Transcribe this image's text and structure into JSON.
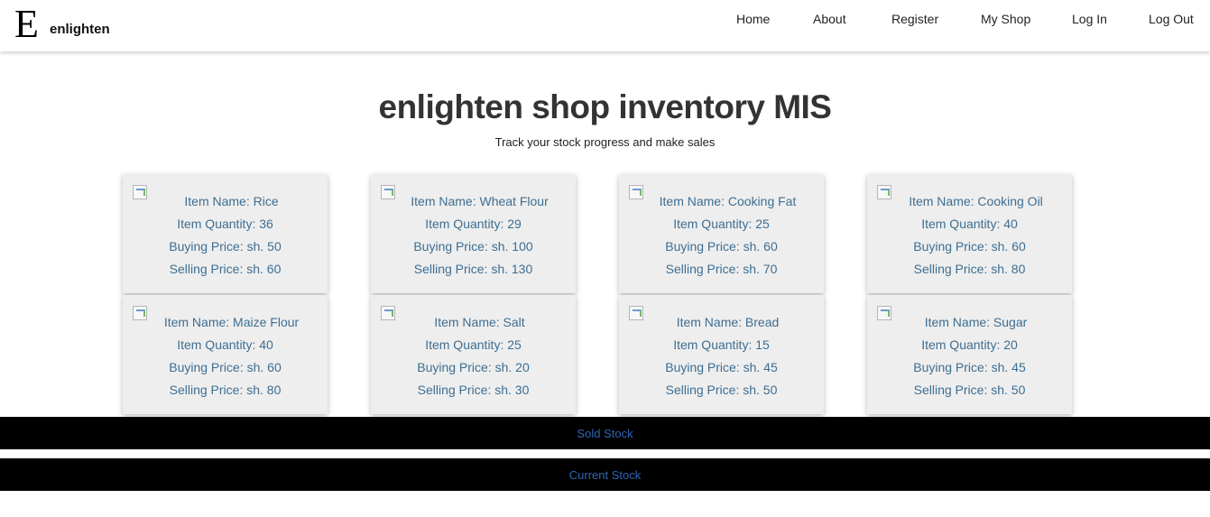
{
  "navbar": {
    "logo_letter": "E",
    "brand": "enlighten",
    "links": [
      "Home",
      "About",
      "Register",
      "My Shop",
      "Log In",
      "Log Out"
    ]
  },
  "header": {
    "title": "enlighten shop inventory MIS",
    "subtitle": "Track your stock progress and make sales"
  },
  "items": [
    {
      "name": "Item Name: Rice",
      "quantity": "Item Quantity: 36",
      "buying": "Buying Price: sh. 50",
      "selling": "Selling Price: sh. 60"
    },
    {
      "name": "Item Name: Wheat Flour",
      "quantity": "Item Quantity: 29",
      "buying": "Buying Price: sh. 100",
      "selling": "Selling Price: sh. 130"
    },
    {
      "name": "Item Name: Cooking Fat",
      "quantity": "Item Quantity: 25",
      "buying": "Buying Price: sh. 60",
      "selling": "Selling Price: sh. 70"
    },
    {
      "name": "Item Name: Cooking Oil",
      "quantity": "Item Quantity: 40",
      "buying": "Buying Price: sh. 60",
      "selling": "Selling Price: sh. 80"
    },
    {
      "name": "Item Name: Maize Flour",
      "quantity": "Item Quantity: 40",
      "buying": "Buying Price: sh. 60",
      "selling": "Selling Price: sh. 80"
    },
    {
      "name": "Item Name: Salt",
      "quantity": "Item Quantity: 25",
      "buying": "Buying Price: sh. 20",
      "selling": "Selling Price: sh. 30"
    },
    {
      "name": "Item Name: Bread",
      "quantity": "Item Quantity: 15",
      "buying": "Buying Price: sh. 45",
      "selling": "Selling Price: sh. 50"
    },
    {
      "name": "Item Name: Sugar",
      "quantity": "Item Quantity: 20",
      "buying": "Buying Price: sh. 45",
      "selling": "Selling Price: sh. 50"
    }
  ],
  "footer": {
    "sold_stock": "Sold Stock",
    "current_stock": "Current Stock"
  },
  "colors": {
    "card_background": "#eeeeee",
    "card_text": "#3d6e92",
    "footer_background": "#000000",
    "footer_link": "#2f66b3"
  },
  "icons": {
    "item_image": "broken-image-icon"
  }
}
